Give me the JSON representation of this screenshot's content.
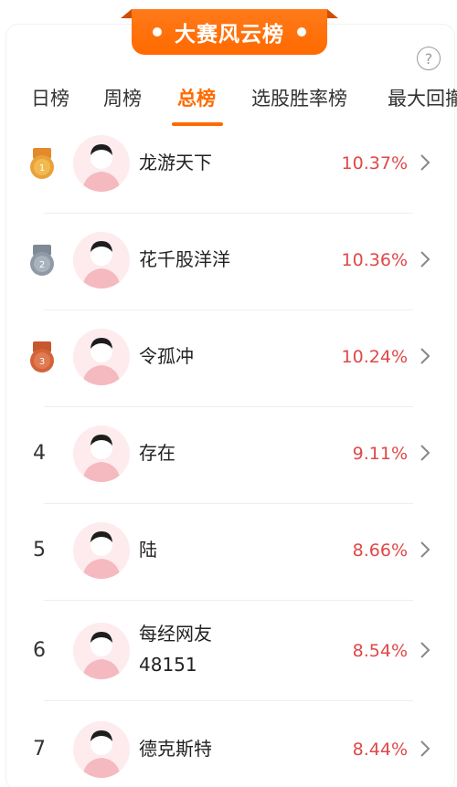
{
  "banner": {
    "title": "大赛风云榜"
  },
  "help_icon": "?",
  "tabs": [
    {
      "label": "日榜"
    },
    {
      "label": "周榜"
    },
    {
      "label": "总榜"
    },
    {
      "label": "选股胜率榜"
    },
    {
      "label": "最大回撤"
    }
  ],
  "rows": [
    {
      "rank": "1",
      "name": "龙游天下",
      "pct": "10.37%"
    },
    {
      "rank": "2",
      "name": "花千股洋洋",
      "pct": "10.36%"
    },
    {
      "rank": "3",
      "name": "令孤冲",
      "pct": "10.24%"
    },
    {
      "rank": "4",
      "name": "存在",
      "pct": "9.11%"
    },
    {
      "rank": "5",
      "name": "陆",
      "pct": "8.66%"
    },
    {
      "rank": "6",
      "name": "每经网友",
      "name2": "48151",
      "pct": "8.54%"
    },
    {
      "rank": "7",
      "name": "德克斯特",
      "pct": "8.44%"
    }
  ],
  "colors": {
    "accent": "#ff6a00",
    "gain": "#e04848",
    "gold": "#e9a23b",
    "silver": "#8f9aa6",
    "bronze": "#d2643a"
  }
}
